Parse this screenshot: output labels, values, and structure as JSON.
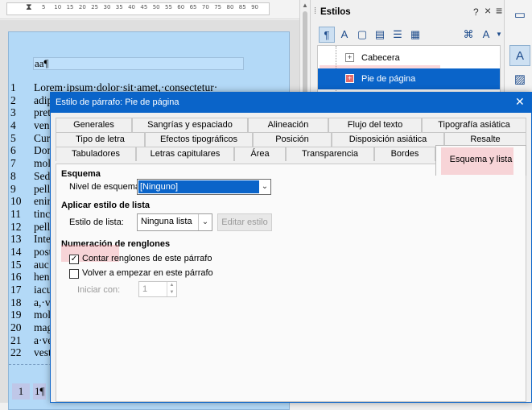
{
  "ruler": {
    "ticks": [
      "5",
      "10",
      "15",
      "20",
      "25",
      "30",
      "35",
      "40",
      "45",
      "50",
      "55",
      "60",
      "65",
      "70",
      "75",
      "80",
      "85",
      "90"
    ]
  },
  "document": {
    "header_text": "aa¶",
    "lines": [
      {
        "num": "1",
        "text": "Lorem·ipsum·dolor·sit·amet,·consectetur·"
      },
      {
        "num": "2",
        "text": "adip"
      },
      {
        "num": "3",
        "text": "pret"
      },
      {
        "num": "4",
        "text": "ven"
      },
      {
        "num": "5",
        "text": "Cur"
      },
      {
        "num": "6",
        "text": "Don"
      },
      {
        "num": "7",
        "text": "mol"
      },
      {
        "num": "8",
        "text": "Sed"
      },
      {
        "num": "9",
        "text": "pell"
      },
      {
        "num": "10",
        "text": "enir"
      },
      {
        "num": "11",
        "text": "tinc"
      },
      {
        "num": "12",
        "text": "pell"
      },
      {
        "num": "13",
        "text": "Inte"
      },
      {
        "num": "14",
        "text": "post"
      },
      {
        "num": "15",
        "text": "auc"
      },
      {
        "num": "16",
        "text": "hen"
      },
      {
        "num": "17",
        "text": "iacu"
      },
      {
        "num": "18",
        "text": "a,·v"
      },
      {
        "num": "19",
        "text": "mol"
      },
      {
        "num": "20",
        "text": "mag"
      },
      {
        "num": "21",
        "text": "a·ve"
      },
      {
        "num": "22",
        "text": "vest"
      }
    ],
    "footer_line_number": "1",
    "footer_text": "1¶"
  },
  "sidebar": {
    "title": "Estilos",
    "help": "?",
    "close": "×",
    "menu": "≡",
    "tree_items": [
      {
        "label": "Cabecera",
        "expander": "+"
      },
      {
        "label": "Pie de página",
        "expander": "+"
      }
    ]
  },
  "dialog": {
    "title": "Estilo de párrafo: Pie de página",
    "close": "✕",
    "tabs_row1": [
      "Generales",
      "Sangrías y espaciado",
      "Alineación",
      "Flujo del texto",
      "Tipografía asiática"
    ],
    "tabs_row2": [
      "Tipo de letra",
      "Efectos tipográficos",
      "Posición",
      "Disposición asiática",
      "Resalte"
    ],
    "tabs_row3": [
      "Tabuladores",
      "Letras capitulares",
      "Área",
      "Transparencia",
      "Bordes"
    ],
    "active_tab": "Esquema y lista",
    "outline_section": "Esquema",
    "outline_level_label": "Nivel de esquema:",
    "outline_level_value": "[Ninguno]",
    "list_section": "Aplicar estilo de lista",
    "list_style_label": "Estilo de lista:",
    "list_style_value": "Ninguna lista",
    "edit_style_button": "Editar estilo",
    "numbering_section": "Numeración de renglones",
    "count_lines_label": "Contar renglones de este párrafo",
    "count_lines_checked": true,
    "restart_label": "Volver a empezar en este párrafo",
    "restart_checked": false,
    "start_with_label": "Iniciar con:",
    "start_with_value": "1"
  }
}
